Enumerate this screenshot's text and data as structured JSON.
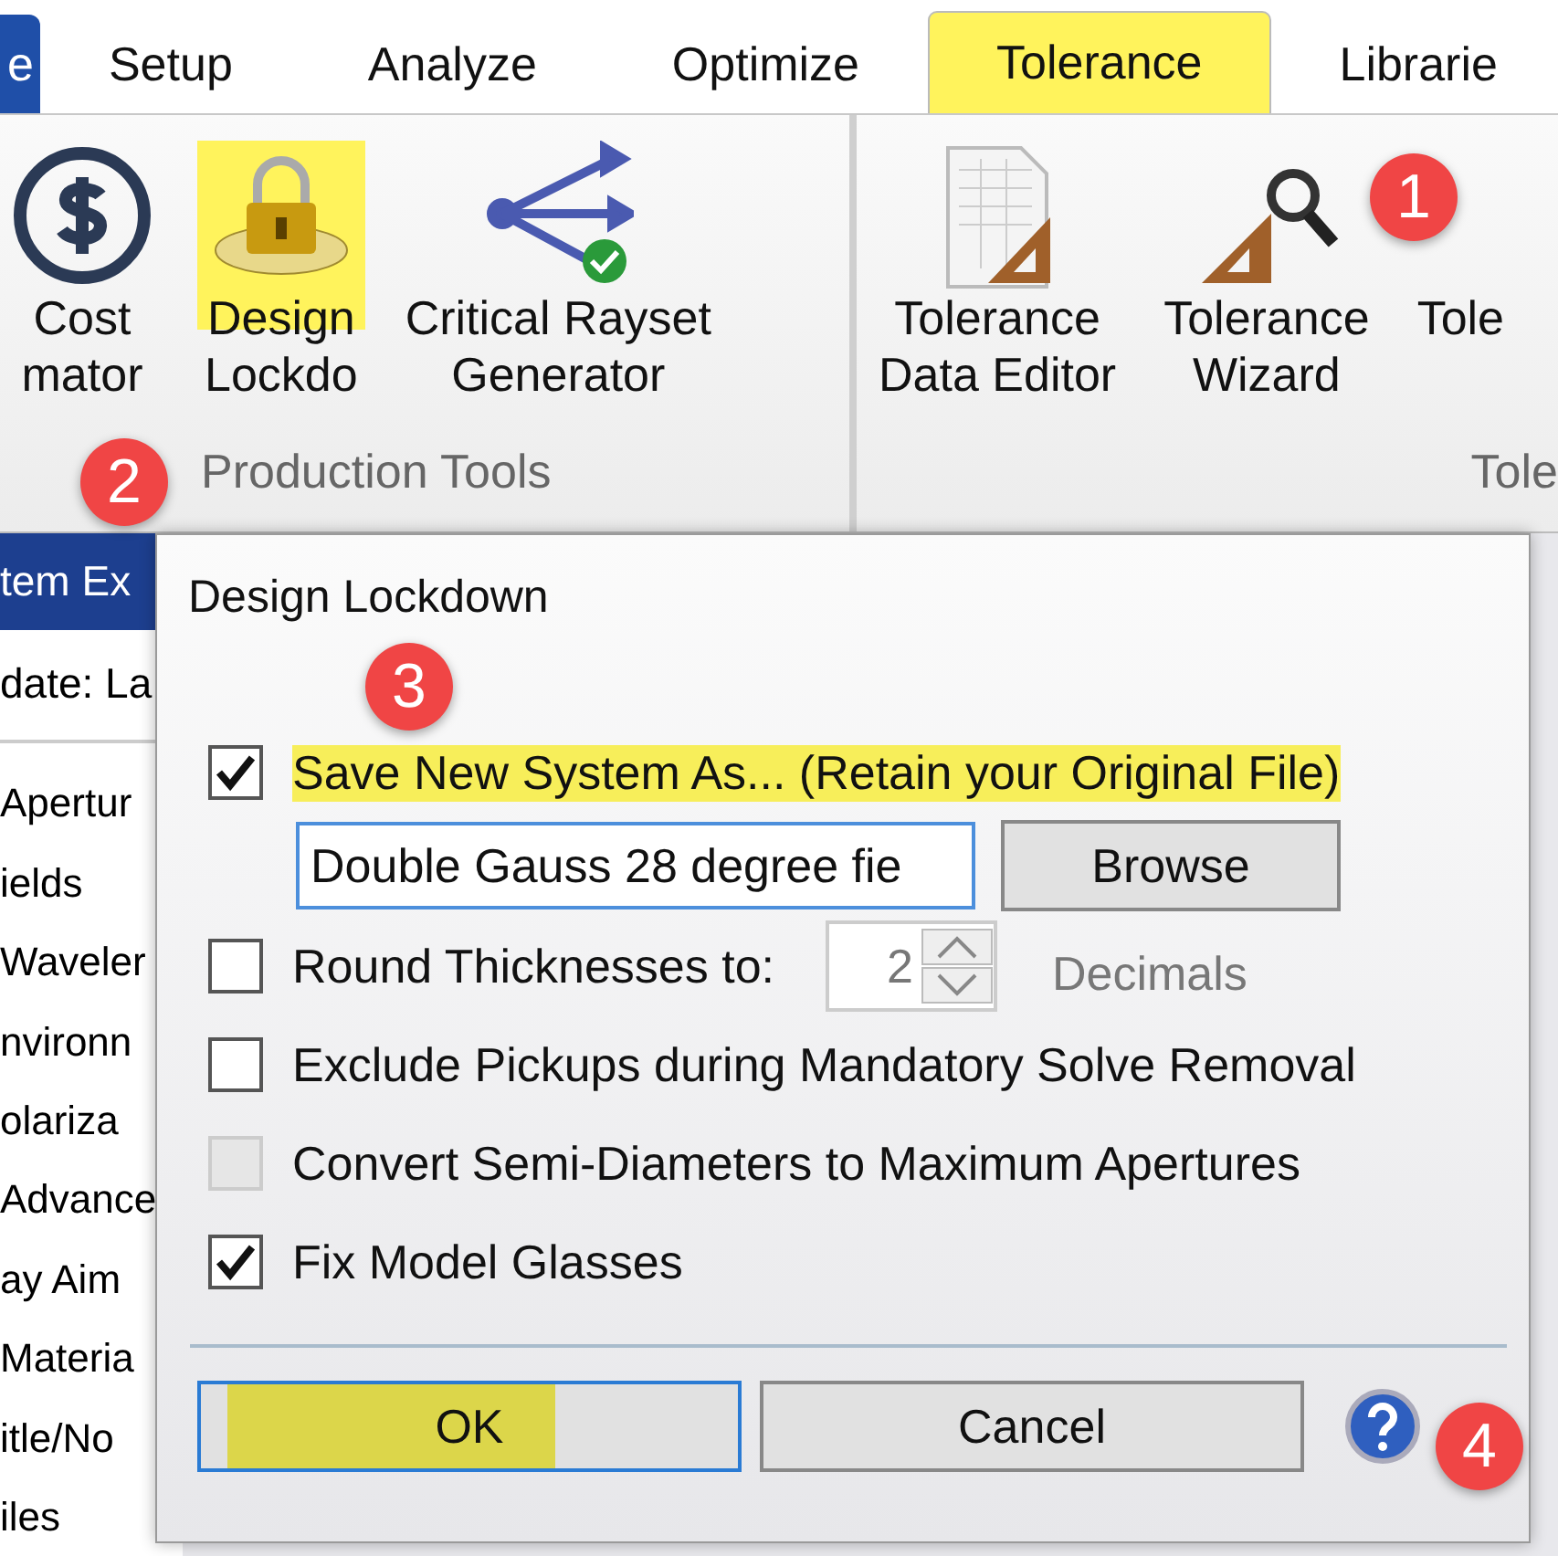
{
  "tabs": [
    {
      "label": "e",
      "selected": false,
      "kind": "file",
      "highlighted": false
    },
    {
      "label": "Setup",
      "selected": false,
      "kind": "tab",
      "highlighted": false
    },
    {
      "label": "Analyze",
      "selected": false,
      "kind": "tab",
      "highlighted": false
    },
    {
      "label": "Optimize",
      "selected": false,
      "kind": "tab",
      "highlighted": false
    },
    {
      "label": "Tolerance",
      "selected": true,
      "kind": "tab",
      "highlighted": true
    },
    {
      "label": "Librarie",
      "selected": false,
      "kind": "tab",
      "highlighted": false
    }
  ],
  "ribbon_groups": [
    {
      "label": "Production Tools",
      "buttons": [
        {
          "kind": "dollar",
          "lines": [
            "Cost",
            "mator"
          ],
          "highlighted": false
        },
        {
          "kind": "lock",
          "lines": [
            "Design",
            "Lockdo"
          ],
          "highlighted": true
        },
        {
          "kind": "rayset",
          "lines": [
            "Critical Rayset",
            "Generator"
          ],
          "highlighted": false
        }
      ]
    },
    {
      "label": "Tole",
      "buttons": [
        {
          "kind": "sheet",
          "lines": [
            "Tolerance",
            "Data Editor"
          ],
          "highlighted": false
        },
        {
          "kind": "wizard",
          "lines": [
            "Tolerance",
            "Wizard"
          ],
          "highlighted": false
        },
        {
          "kind": "label",
          "lines": [
            "Tole"
          ],
          "highlighted": false
        }
      ]
    }
  ],
  "side_panel": {
    "title": "tem Ex",
    "update": "date: La",
    "items": [
      "Apertur",
      "ields",
      "Waveler",
      "nvironn",
      "olariza",
      "Advance",
      "ay Aim",
      "Materia",
      "itle/No",
      "iles"
    ]
  },
  "dialog": {
    "title": "Design Lockdown",
    "options": [
      {
        "kind": "file",
        "label": "Save New System As... (Retain your Original File)",
        "checked": true,
        "disabled": false,
        "highlighted": true,
        "value": "Double Gauss 28 degree fie",
        "button": "Browse"
      },
      {
        "kind": "number",
        "label": "Round Thicknesses to:",
        "checked": false,
        "disabled": false,
        "highlighted": false,
        "value": "2",
        "unit": "Decimals"
      },
      {
        "kind": "plain",
        "label": "Exclude Pickups during Mandatory Solve Removal",
        "checked": false,
        "disabled": false,
        "highlighted": false
      },
      {
        "kind": "plain",
        "label": "Convert Semi-Diameters to Maximum Apertures",
        "checked": false,
        "disabled": true,
        "highlighted": false
      },
      {
        "kind": "plain",
        "label": "Fix Model Glasses",
        "checked": true,
        "disabled": false,
        "highlighted": false
      }
    ],
    "buttons": [
      {
        "label": "OK",
        "highlighted": true
      },
      {
        "label": "Cancel",
        "highlighted": false
      }
    ]
  },
  "callouts": [
    "1",
    "2",
    "3",
    "4"
  ]
}
